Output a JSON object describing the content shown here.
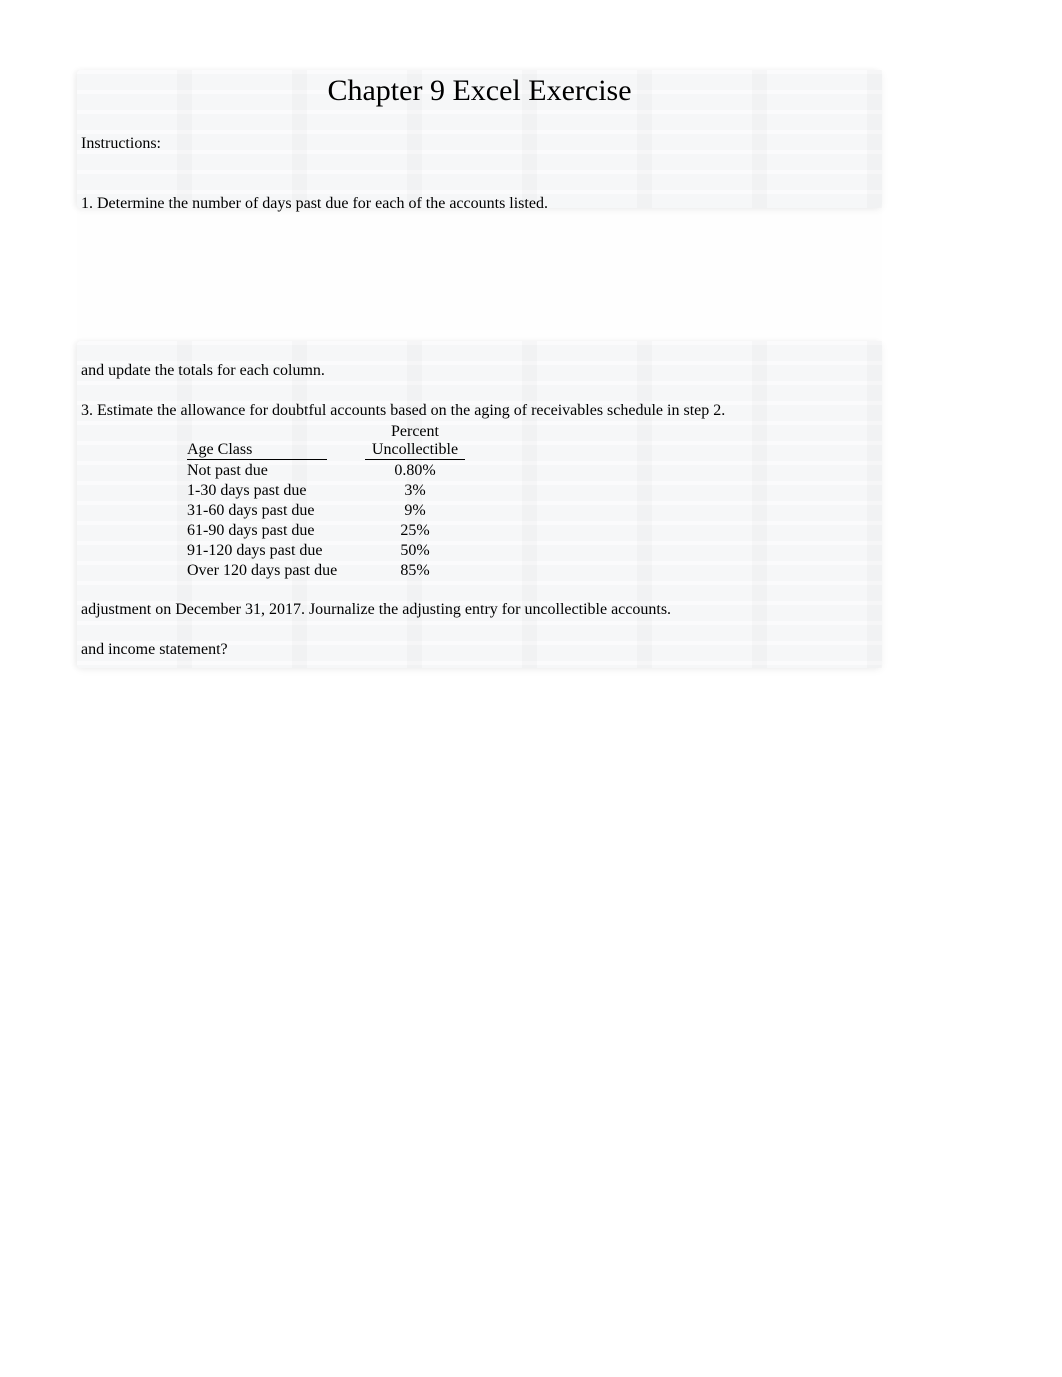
{
  "title": "Chapter 9 Excel Exercise",
  "instructions_label": "Instructions:",
  "step1": "1. Determine the number of days past due for each of the accounts listed.",
  "line_update": "and update the totals for each column.",
  "step3": "3. Estimate the allowance for doubtful accounts based on the aging of receivables schedule in step 2.",
  "table_header": {
    "age_class": "Age Class",
    "percent_line1": "Percent",
    "percent_line2": "Uncollectible"
  },
  "aging": [
    {
      "label": "Not past due",
      "pct": "0.80%"
    },
    {
      "label": "1-30 days past due",
      "pct": "3%"
    },
    {
      "label": "31-60 days past due",
      "pct": "9%"
    },
    {
      "label": "61-90 days past due",
      "pct": "25%"
    },
    {
      "label": "91-120 days past due",
      "pct": "50%"
    },
    {
      "label": "Over 120 days past due",
      "pct": "85%"
    }
  ],
  "line_adjustment": "adjustment on December 31, 2017. Journalize the adjusting entry for uncollectible accounts.",
  "line_income": "and income statement?"
}
